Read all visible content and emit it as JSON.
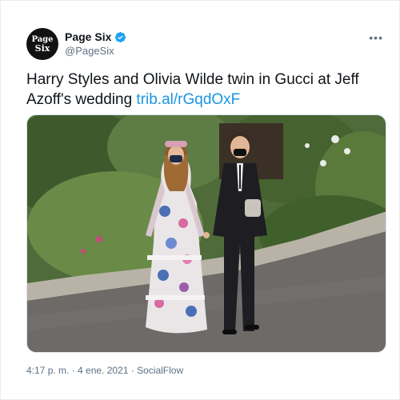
{
  "account": {
    "avatar_line1": "Page",
    "avatar_line2": "Six",
    "name": "Page Six",
    "handle": "@PageSix"
  },
  "menu_label": "•••",
  "tweet": {
    "text": "Harry Styles and Olivia Wilde twin in Gucci at Jeff Azoff's wedding",
    "link": "trib.al/rGqdOxF"
  },
  "footer": {
    "time": "4:17 p. m.",
    "separator1": " · ",
    "date": "4 ene. 2021",
    "separator2": " · ",
    "source": "SocialFlow"
  },
  "colors": {
    "link": "#1b95e0",
    "verified": "#1da1f2",
    "secondary_text": "#5b7083"
  },
  "icons": {
    "verified": "verified-badge-icon",
    "more": "more-options-icon"
  }
}
